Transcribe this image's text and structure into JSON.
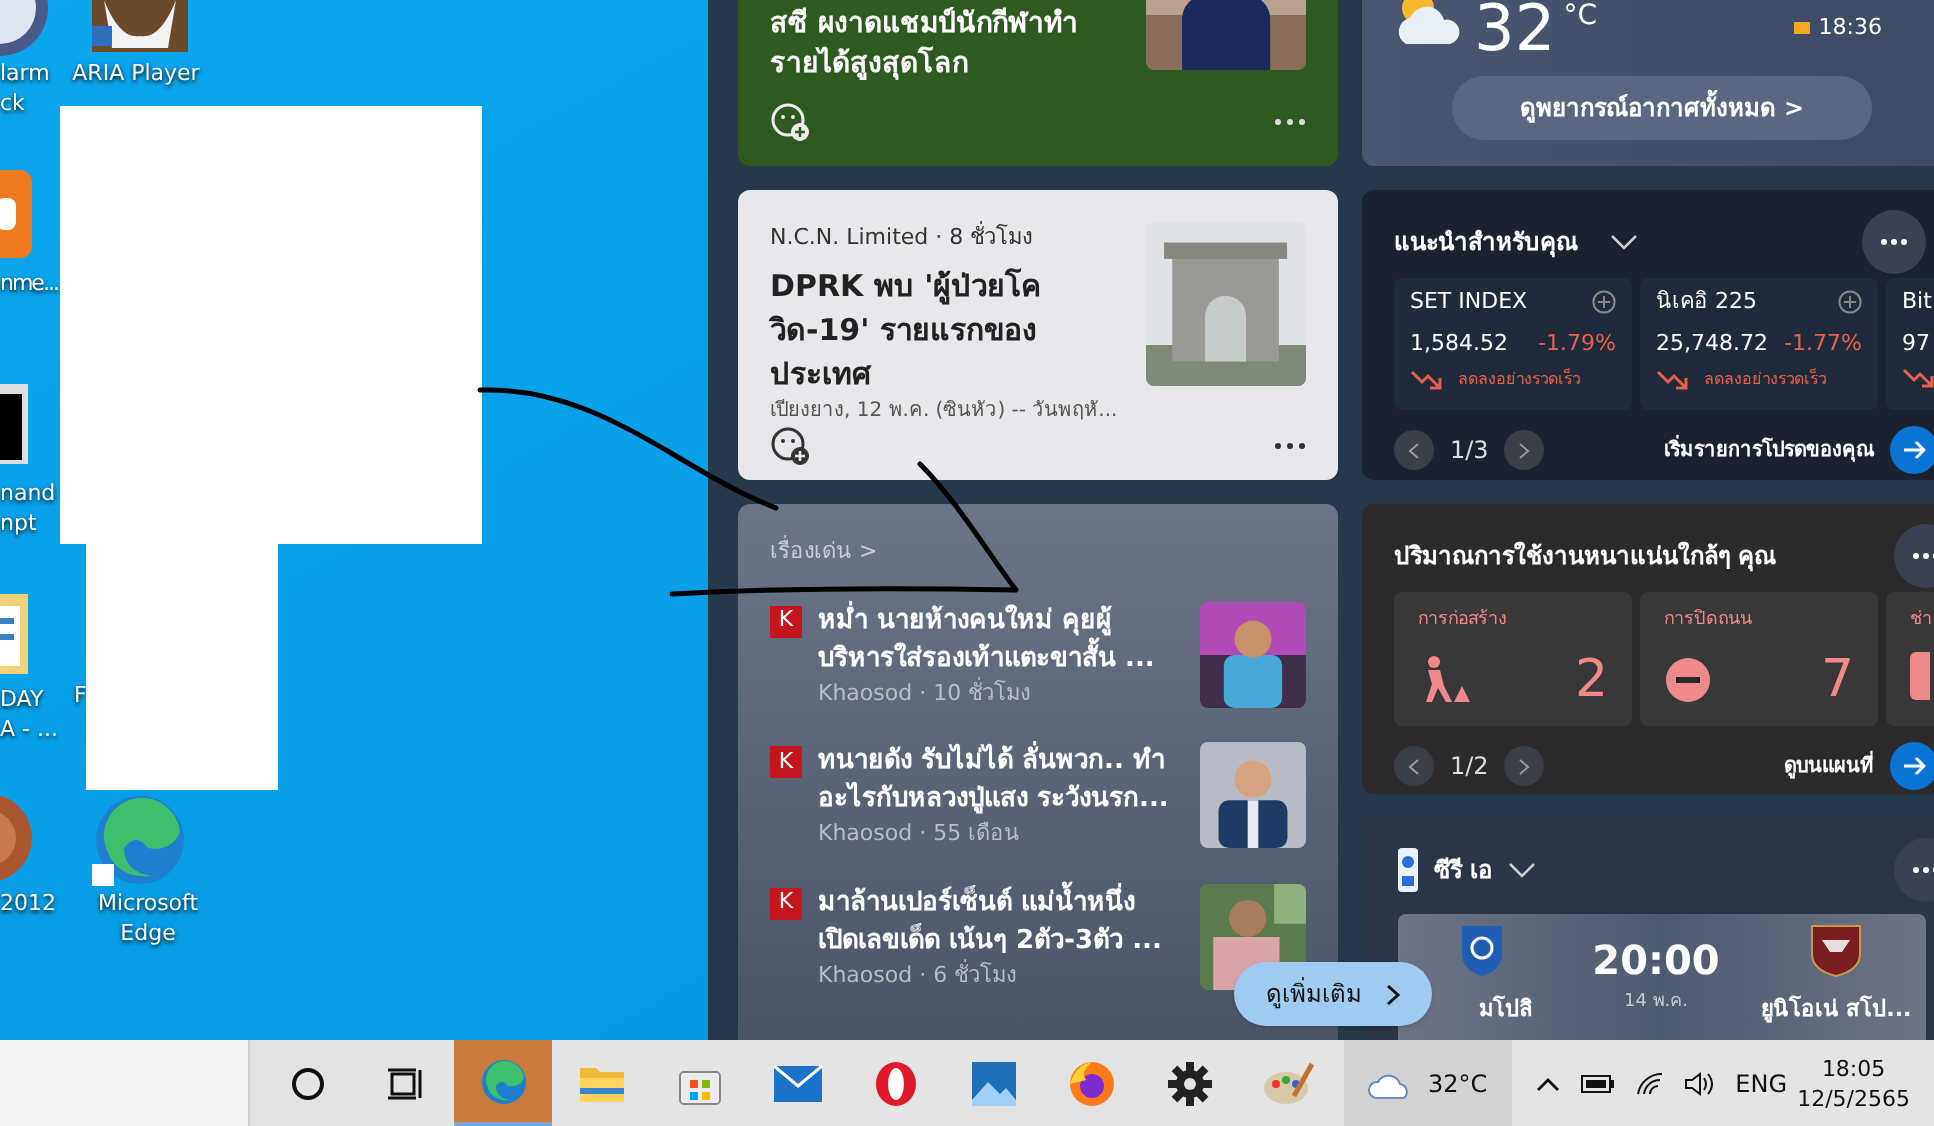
{
  "desktop_icons": [
    {
      "kind": "alarm",
      "label": "larm\nck"
    },
    {
      "kind": "orange-app",
      "label": "nme..."
    },
    {
      "kind": "terminal",
      "label": "nand\nnpt"
    },
    {
      "kind": "document",
      "label": "DAY\nA - ..."
    },
    {
      "kind": "disc",
      "label": "2012"
    },
    {
      "kind": "gnu",
      "label": "ARIA Player"
    },
    {
      "kind": "hidden",
      "label": "F"
    },
    {
      "kind": "edge",
      "label": "Microsoft\nEdge"
    }
  ],
  "news": {
    "feature": {
      "title": "สซี ผงาดแชมป์นักกีฬาทำรายได้สูงสุดโลก"
    },
    "story": {
      "source": "N.C.N. Limited · 8 ชั่วโมง",
      "title": "DPRK พบ 'ผู้ป่วยโควิด-19' รายแรกของประเทศ",
      "snippet": "เปียงยาง, 12 พ.ค. (ซินหัว) -- วันพฤหั..."
    },
    "top_stories": {
      "heading": "เรื่องเด่น >",
      "items": [
        {
          "badge": "K",
          "title": "หม่ำ นายห้างคนใหม่ คุยผู้บริหารใส่รองเท้าแตะขาสั้น ...",
          "meta": "Khaosod · 10 ชั่วโมง"
        },
        {
          "badge": "K",
          "title": "ทนายดัง รับไม่ได้ ลั่นพวก.. ทำอะไรกับหลวงปู่แสง ระวังนรก...",
          "meta": "Khaosod · 55 เดือน"
        },
        {
          "badge": "K",
          "title": "มาล้านเปอร์เซ็นต์ แม่น้ำหนึ่ง เปิดเลขเด็ด เน้นๆ 2ตัว-3ตัว ...",
          "meta": "Khaosod · 6 ชั่วโมง"
        }
      ],
      "more_button": "ดูเพิ่มเติม"
    }
  },
  "weather": {
    "temp": "32",
    "unit": "°C",
    "sunset": "18:36",
    "forecast_button": "ดูพยากรณ์อากาศทั้งหมด >"
  },
  "stocks": {
    "title": "แนะนำสำหรับคุณ",
    "tiles": [
      {
        "name": "SET INDEX",
        "value": "1,584.52",
        "change": "-1.79%",
        "trend": "ลดลงอย่างรวดเร็ว"
      },
      {
        "name": "นิเคอิ 225",
        "value": "25,748.72",
        "change": "-1.77%",
        "trend": "ลดลงอย่างรวดเร็ว"
      },
      {
        "name": "Bit",
        "value": "97"
      }
    ],
    "page": "1/3",
    "link": "เริ่มรายการโปรดของคุณ"
  },
  "traffic": {
    "title": "ปริมาณการใช้งานหนาแน่นใกล้ๆ คุณ",
    "tiles": [
      {
        "label": "การก่อสร้าง",
        "kind": "construction",
        "count": "2"
      },
      {
        "label": "การปิดถนน",
        "kind": "closure",
        "count": "7"
      },
      {
        "label": "ช่า",
        "kind": "other"
      }
    ],
    "page": "1/2",
    "link": "ดูบนแผนที่"
  },
  "sports": {
    "title": "ซีรี เอ",
    "time": "20:00",
    "date": "14 พ.ค.",
    "home": "มโปลิ",
    "away": "ยูนิโอเน่ สโป..."
  },
  "taskbar": {
    "apps": [
      {
        "kind": "cortana",
        "selected": false
      },
      {
        "kind": "taskview",
        "selected": false
      },
      {
        "kind": "edge",
        "selected": true
      },
      {
        "kind": "folder",
        "selected": false
      },
      {
        "kind": "store",
        "selected": false
      },
      {
        "kind": "mail",
        "selected": false
      },
      {
        "kind": "opera",
        "selected": false
      },
      {
        "kind": "photos",
        "selected": false
      },
      {
        "kind": "firefox",
        "selected": false
      },
      {
        "kind": "settings",
        "selected": false
      },
      {
        "kind": "paint",
        "selected": false
      }
    ],
    "weather": "32°C",
    "language": "ENG",
    "time": "18:05",
    "date": "12/5/2565"
  }
}
